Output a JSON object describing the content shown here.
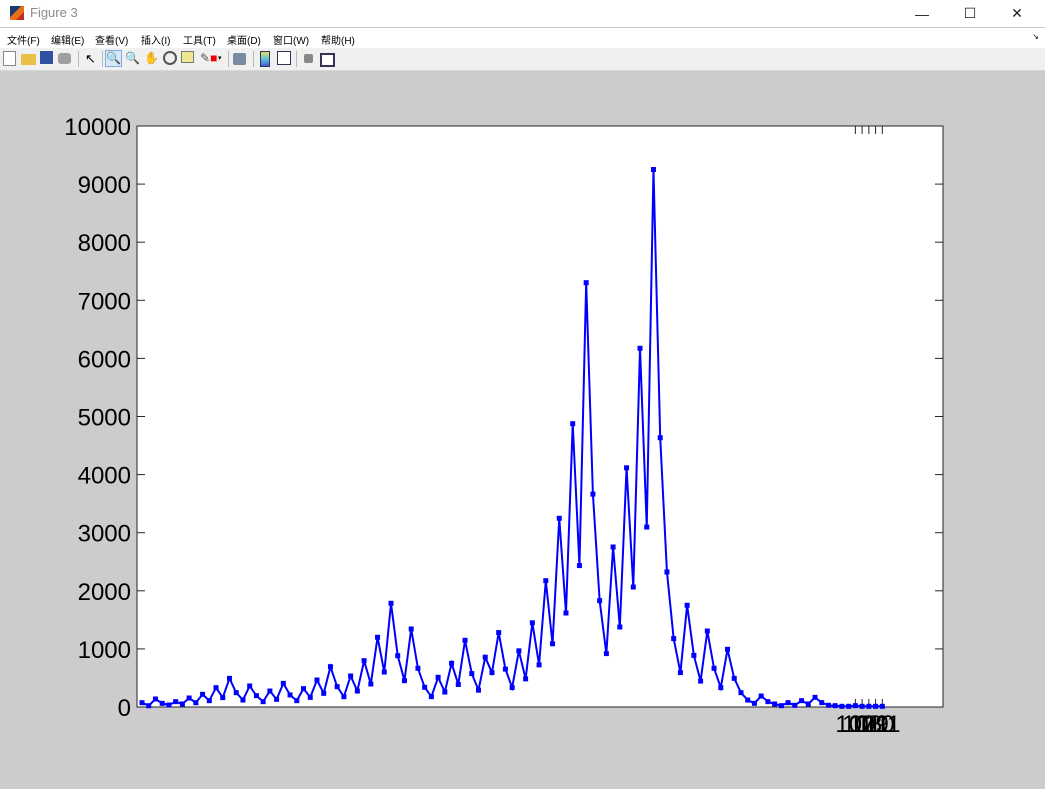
{
  "window": {
    "title": "Figure 3",
    "minimize": "—",
    "maximize": "☐",
    "close": "✕"
  },
  "menu": [
    "文件(F)",
    "编辑(E)",
    "查看(V)",
    "插入(I)",
    "工具(T)",
    "桌面(D)",
    "窗口(W)",
    "帮助(H)"
  ],
  "menu_arrow": "↘",
  "toolbar": [
    "new-figure",
    "open-file",
    "save",
    "print",
    "edit-plot",
    "zoom-in",
    "zoom-out",
    "pan",
    "rotate-3d",
    "data-cursor",
    "brush",
    "brush-menu",
    "link-plot",
    "insert-colorbar",
    "insert-legend",
    "hide-plot-tools",
    "show-plot-tools"
  ],
  "colors": {
    "line": "#0000ff",
    "background": "#cccccc",
    "axes": "#ffffff"
  },
  "chart_data": {
    "type": "line",
    "title": "",
    "xlabel": "",
    "ylabel": "",
    "marker": "square",
    "xlim": [
      1,
      120
    ],
    "ylim": [
      0,
      10000
    ],
    "yticks": [
      0,
      1000,
      2000,
      3000,
      4000,
      5000,
      6000,
      7000,
      8000,
      9000,
      10000
    ],
    "ytick_labels": [
      "0",
      "1000",
      "2000",
      "3000",
      "4000",
      "5000",
      "6000",
      "7000",
      "8000",
      "9000",
      "10000"
    ],
    "xticks": [
      107,
      108,
      109,
      110,
      111
    ],
    "xtick_labels": [
      "107",
      "108",
      "109",
      "110",
      "111"
    ],
    "grid": false,
    "series": [
      {
        "name": "data",
        "values": [
          74,
          22,
          138,
          63,
          34,
          92,
          52,
          155,
          74,
          218,
          109,
          333,
          161,
          493,
          247,
          120,
          362,
          195,
          92,
          275,
          132,
          407,
          207,
          109,
          316,
          166,
          465,
          235,
          694,
          350,
          178,
          534,
          275,
          797,
          396,
          1200,
          602,
          1785,
          883,
          453,
          1343,
          666,
          339,
          178,
          511,
          258,
          752,
          388,
          1148,
          575,
          291,
          857,
          592,
          1281,
          652,
          334,
          967,
          484,
          1449,
          725,
          2174,
          1088,
          3248,
          1618,
          4876,
          2434,
          7303,
          3664,
          1830,
          919,
          2754,
          1377,
          4117,
          2065,
          6174,
          3097,
          9251,
          4635,
          2324,
          1177,
          592,
          1751,
          888,
          446,
          1308,
          666,
          333,
          993,
          493,
          247,
          120,
          63,
          189,
          92,
          52,
          23,
          75,
          29,
          109,
          52,
          166,
          75,
          29,
          23,
          12,
          12,
          23,
          12,
          12,
          12,
          12
        ]
      }
    ]
  }
}
